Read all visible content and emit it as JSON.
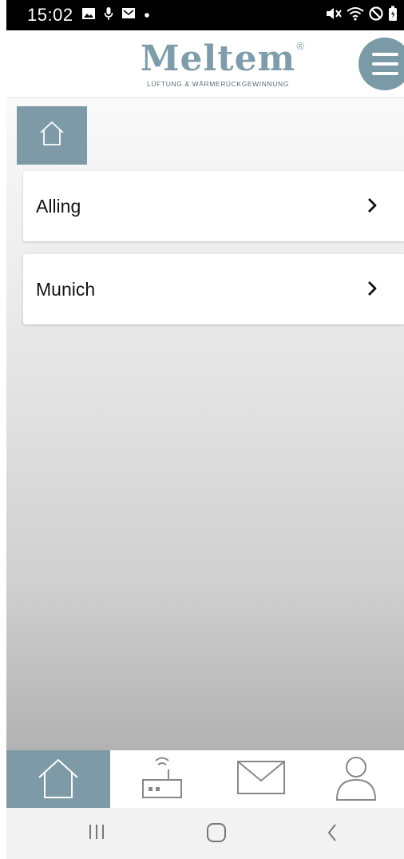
{
  "status_bar": {
    "time": "15:02",
    "left_icons": [
      "image-icon",
      "microphone-icon",
      "mail-icon",
      "dot-icon"
    ],
    "right_icons": [
      "mute-icon",
      "wifi-icon",
      "do-not-disturb-icon",
      "battery-icon"
    ]
  },
  "header": {
    "logo_text": "Meltem",
    "logo_registered": "®",
    "logo_tagline": "LÜFTUNG & WÄRMERÜCKGEWINNUNG",
    "menu_icon": "hamburger-menu-icon"
  },
  "breadcrumb": {
    "home_icon": "home-icon"
  },
  "locations": [
    {
      "label": "Alling"
    },
    {
      "label": "Munich"
    }
  ],
  "bottom_nav": [
    {
      "id": "home",
      "icon": "home-icon",
      "active": true
    },
    {
      "id": "devices",
      "icon": "router-icon",
      "active": false
    },
    {
      "id": "messages",
      "icon": "envelope-icon",
      "active": false
    },
    {
      "id": "profile",
      "icon": "user-icon",
      "active": false
    }
  ],
  "system_nav": [
    "recents-button",
    "home-button",
    "back-button"
  ],
  "colors": {
    "accent": "#7d9aa6",
    "logo": "#7f9caa",
    "status_bar": "#000000",
    "card": "#ffffff"
  }
}
